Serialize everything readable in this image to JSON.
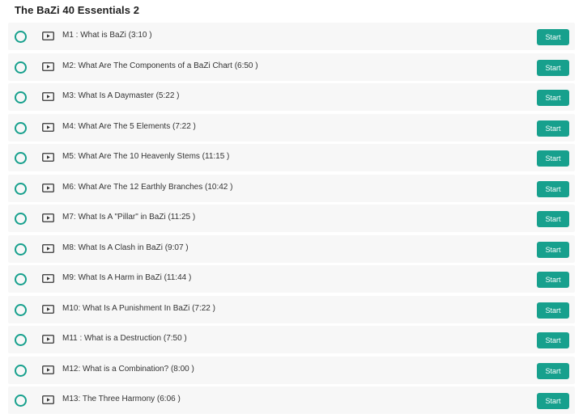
{
  "course": {
    "section_title": "The BaZi 40 Essentials 2"
  },
  "icons": {
    "status": "circle-outline-icon",
    "lesson_type": "video-play-icon"
  },
  "colors": {
    "accent": "#17a08d",
    "row_background": "#f7f7f7"
  },
  "lessons": [
    {
      "title": "M1 : What is BaZi (3:10 )",
      "button_label": "Start"
    },
    {
      "title": "M2: What Are The Components of a BaZi Chart (6:50 )",
      "button_label": "Start"
    },
    {
      "title": "M3: What Is A Daymaster (5:22 )",
      "button_label": "Start"
    },
    {
      "title": "M4: What Are The 5 Elements (7:22 )",
      "button_label": "Start"
    },
    {
      "title": "M5: What Are The 10 Heavenly Stems (11:15 )",
      "button_label": "Start"
    },
    {
      "title": "M6: What Are The 12 Earthly Branches (10:42 )",
      "button_label": "Start"
    },
    {
      "title": "M7: What Is A \"Pillar\" in BaZi (11:25 )",
      "button_label": "Start"
    },
    {
      "title": "M8: What Is A Clash in BaZi (9:07 )",
      "button_label": "Start"
    },
    {
      "title": "M9: What Is A Harm in BaZi (11:44 )",
      "button_label": "Start"
    },
    {
      "title": "M10: What Is A Punishment In BaZi (7:22 )",
      "button_label": "Start"
    },
    {
      "title": "M11 : What is a Destruction (7:50 )",
      "button_label": "Start"
    },
    {
      "title": "M12: What is a Combination? (8:00 )",
      "button_label": "Start"
    },
    {
      "title": "M13: The Three Harmony (6:06 )",
      "button_label": "Start"
    }
  ]
}
